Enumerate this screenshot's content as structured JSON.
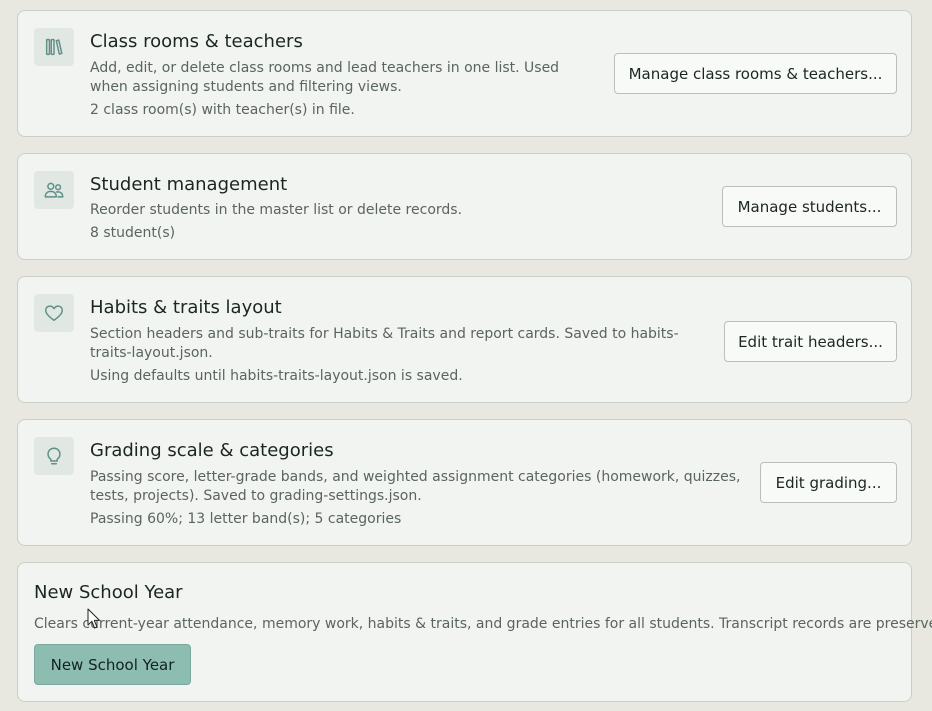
{
  "colors": {
    "page_background": "#e8e8e0",
    "card_background": "#f1f4f0",
    "icon_accent": "#5f8f87",
    "primary_button": "#8dbcb1"
  },
  "cards": [
    {
      "icon": "books-icon",
      "title": "Class rooms & teachers",
      "description": "Add, edit, or delete class rooms and lead teachers in one list. Used when assigning students and filtering views.",
      "status": "2 class room(s) with teacher(s) in file.",
      "button_label": "Manage class rooms & teachers..."
    },
    {
      "icon": "people-icon",
      "title": "Student management",
      "description": "Reorder students in the master list or delete records.",
      "status": "8 student(s)",
      "button_label": "Manage students..."
    },
    {
      "icon": "heart-icon",
      "title": "Habits & traits layout",
      "description": "Section headers and sub-traits for Habits & Traits and report cards. Saved to habits-traits-layout.json.",
      "status": "Using defaults until habits-traits-layout.json is saved.",
      "button_label": "Edit trait headers..."
    },
    {
      "icon": "lightbulb-icon",
      "title": "Grading scale & categories",
      "description": "Passing score, letter-grade bands, and weighted assignment categories (homework, quizzes, tests, projects). Saved to grading-settings.json.",
      "status": "Passing 60%; 13 letter band(s); 5 categories",
      "button_label": "Edit grading..."
    }
  ],
  "new_school_year": {
    "title": "New School Year",
    "description": "Clears current-year attendance, memory work, habits & traits, and grade entries for all students. Transcript records are preserved.",
    "button_label": "New School Year"
  }
}
